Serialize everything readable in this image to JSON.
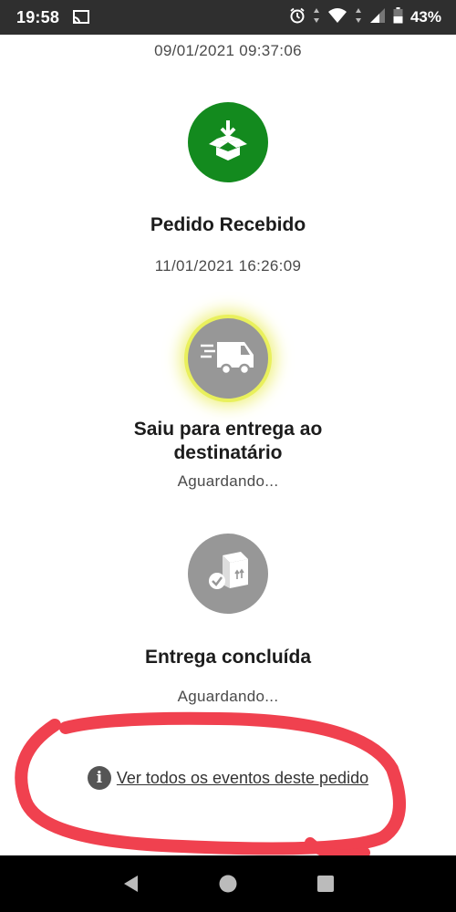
{
  "status_bar": {
    "time": "19:58",
    "battery": "43%",
    "icons": [
      "cast-icon",
      "alarm-icon",
      "data-arrows-icon",
      "wifi-icon",
      "signal-icon",
      "battery-icon"
    ]
  },
  "timeline": {
    "top_date": "09/01/2021 09:37:06",
    "steps": [
      {
        "title": "Pedido Recebido",
        "sub": "11/01/2021 16:26:09",
        "icon": "box-download-icon",
        "state": "done",
        "color": "#138a1e"
      },
      {
        "title": "Saiu para entrega ao destinatário",
        "sub": "Aguardando...",
        "icon": "delivery-truck-icon",
        "state": "current",
        "color": "#979797"
      },
      {
        "title": "Entrega concluída",
        "sub": "Aguardando...",
        "icon": "package-check-icon",
        "state": "pending",
        "color": "#979797"
      }
    ]
  },
  "events_link": {
    "label": "Ver todos os eventos deste pedido",
    "icon": "info-icon"
  },
  "nav_bar": {
    "icons": [
      "back-icon",
      "home-icon",
      "recents-icon"
    ]
  },
  "annotation_color": "#f0414f"
}
